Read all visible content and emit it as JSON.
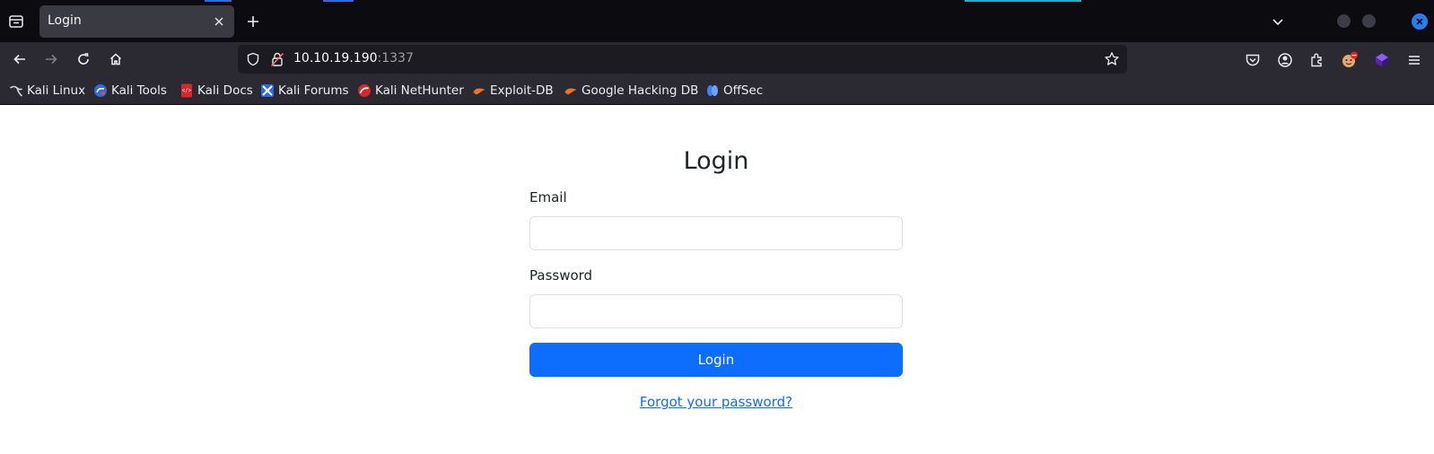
{
  "browser": {
    "tab": {
      "title": "Login"
    },
    "url": {
      "host": "10.10.19.190",
      "port": ":1337"
    },
    "icons": {
      "tab_list": "tab-list-icon",
      "close_tab": "close-icon",
      "new_tab": "plus-icon",
      "list_all_tabs": "chevron-down-icon",
      "back": "back-arrow-icon",
      "forward": "forward-arrow-icon",
      "reload": "reload-icon",
      "home": "home-icon",
      "site_info": "shield-icon",
      "insecure": "lock-strike-icon",
      "bookmark": "star-icon",
      "pocket": "pocket-icon",
      "account": "account-icon",
      "extensions": "puzzle-icon",
      "menu": "hamburger-menu-icon"
    },
    "bookmarks": [
      {
        "label": "Kali Linux",
        "icon": "kali-dragon-icon"
      },
      {
        "label": "Kali Tools",
        "icon": "kali-tools-icon"
      },
      {
        "label": "Kali Docs",
        "icon": "kali-docs-icon"
      },
      {
        "label": "Kali Forums",
        "icon": "kali-forums-icon"
      },
      {
        "label": "Kali NetHunter",
        "icon": "nethunter-icon"
      },
      {
        "label": "Exploit-DB",
        "icon": "exploit-db-icon"
      },
      {
        "label": "Google Hacking DB",
        "icon": "ghdb-icon"
      },
      {
        "label": "OffSec",
        "icon": "offsec-icon"
      }
    ],
    "colors": {
      "accent": "#2a7cf0",
      "chrome_dark": "#0b0b10",
      "toolbar": "#2b2a33"
    }
  },
  "page": {
    "heading": "Login",
    "email_label": "Email",
    "email_value": "",
    "password_label": "Password",
    "password_value": "",
    "submit_label": "Login",
    "forgot_link": "Forgot your password?",
    "colors": {
      "primary": "#0d6efd",
      "text": "#212529",
      "input_border": "#dee2e6"
    }
  }
}
